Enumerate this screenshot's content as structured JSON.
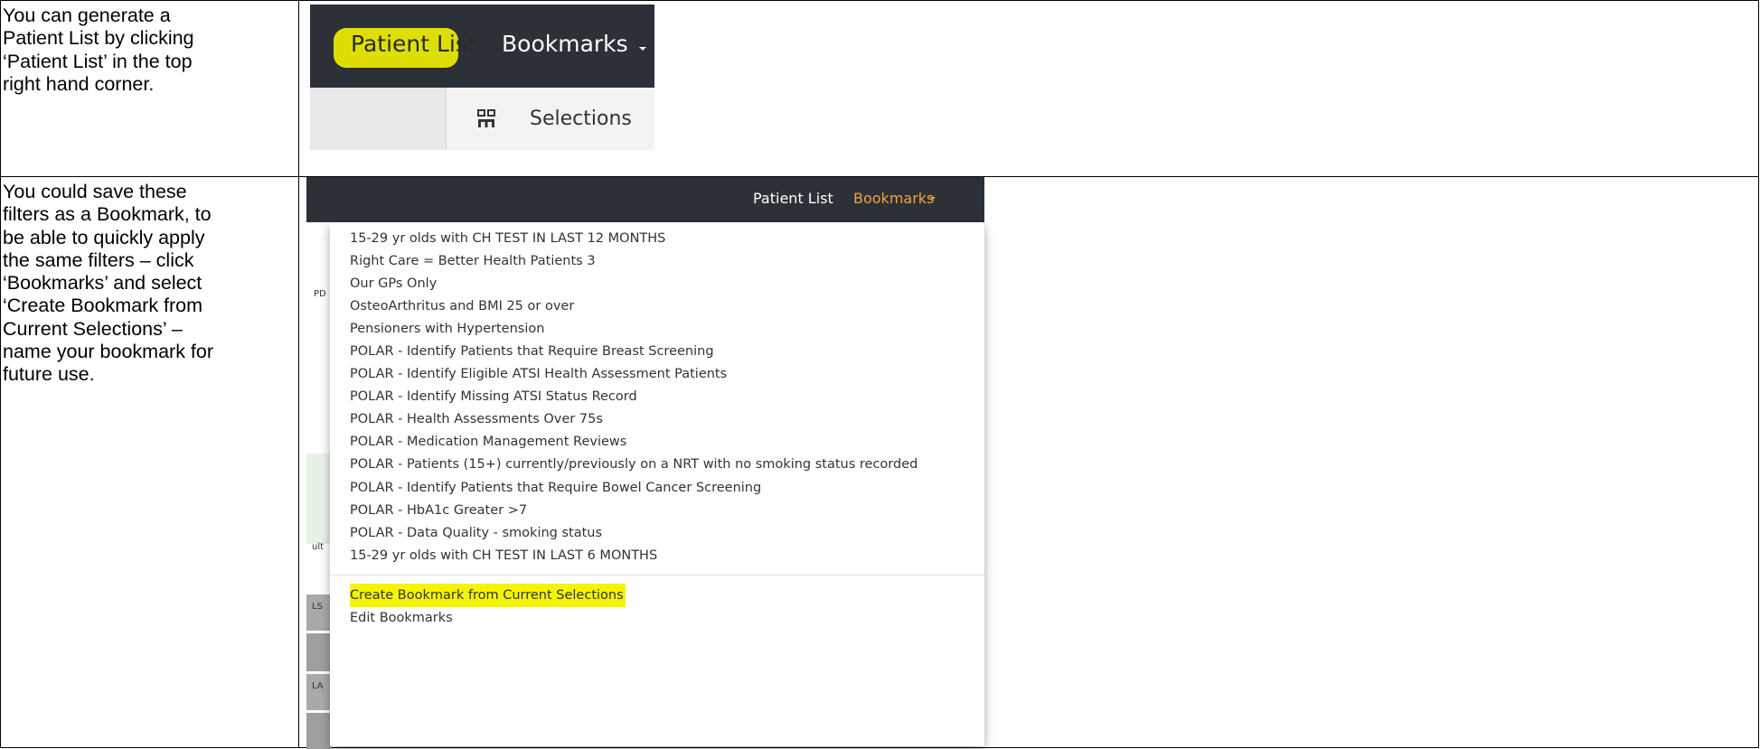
{
  "rows": [
    {
      "instruction": "You can generate a\nPatient List by clicking\n‘Patient List’ in the top\nright hand corner.",
      "screenshot": {
        "nav": {
          "patient_list": "Patient List",
          "bookmarks": "Bookmarks",
          "highlight_color": "#f2f200"
        },
        "toolbar": {
          "selections": "Selections"
        }
      }
    },
    {
      "instruction": "You could save these\nfilters as a Bookmark, to\nbe able to quickly apply\nthe same filters – click\n‘Bookmarks’ and select\n‘Create Bookmark from\nCurrent Selections’ –\nname your bookmark for\nfuture use.",
      "screenshot": {
        "nav": {
          "patient_list": "Patient List",
          "bookmarks": "Bookmarks",
          "bookmarks_color": "#f0a23b"
        },
        "bookmarks_menu": {
          "items": [
            "15-29 yr olds with CH TEST IN LAST 12 MONTHS",
            "Right Care = Better Health Patients 3",
            "Our GPs Only",
            "OsteoArthritus and BMI 25 or over",
            "Pensioners with Hypertension",
            "POLAR - Identify Patients that Require Breast Screening",
            "POLAR - Identify Eligible ATSI Health Assessment Patients",
            "POLAR - Identify Missing ATSI Status Record",
            "POLAR - Health Assessments Over 75s",
            "POLAR - Medication Management Reviews",
            "POLAR - Patients (15+) currently/previously on a NRT with no smoking status recorded",
            "POLAR - Identify Patients that Require Bowel Cancer Screening",
            "POLAR - HbA1c Greater >7",
            "POLAR - Data Quality - smoking status",
            "15-29 yr olds with CH TEST IN LAST 6 MONTHS"
          ],
          "create": "Create Bookmark from Current Selections",
          "edit": "Edit Bookmarks",
          "highlight_color": "#f5f500"
        },
        "background_fragments": {
          "a": "PD",
          "b": "ult",
          "c": "LS",
          "d": "LA"
        }
      }
    }
  ]
}
